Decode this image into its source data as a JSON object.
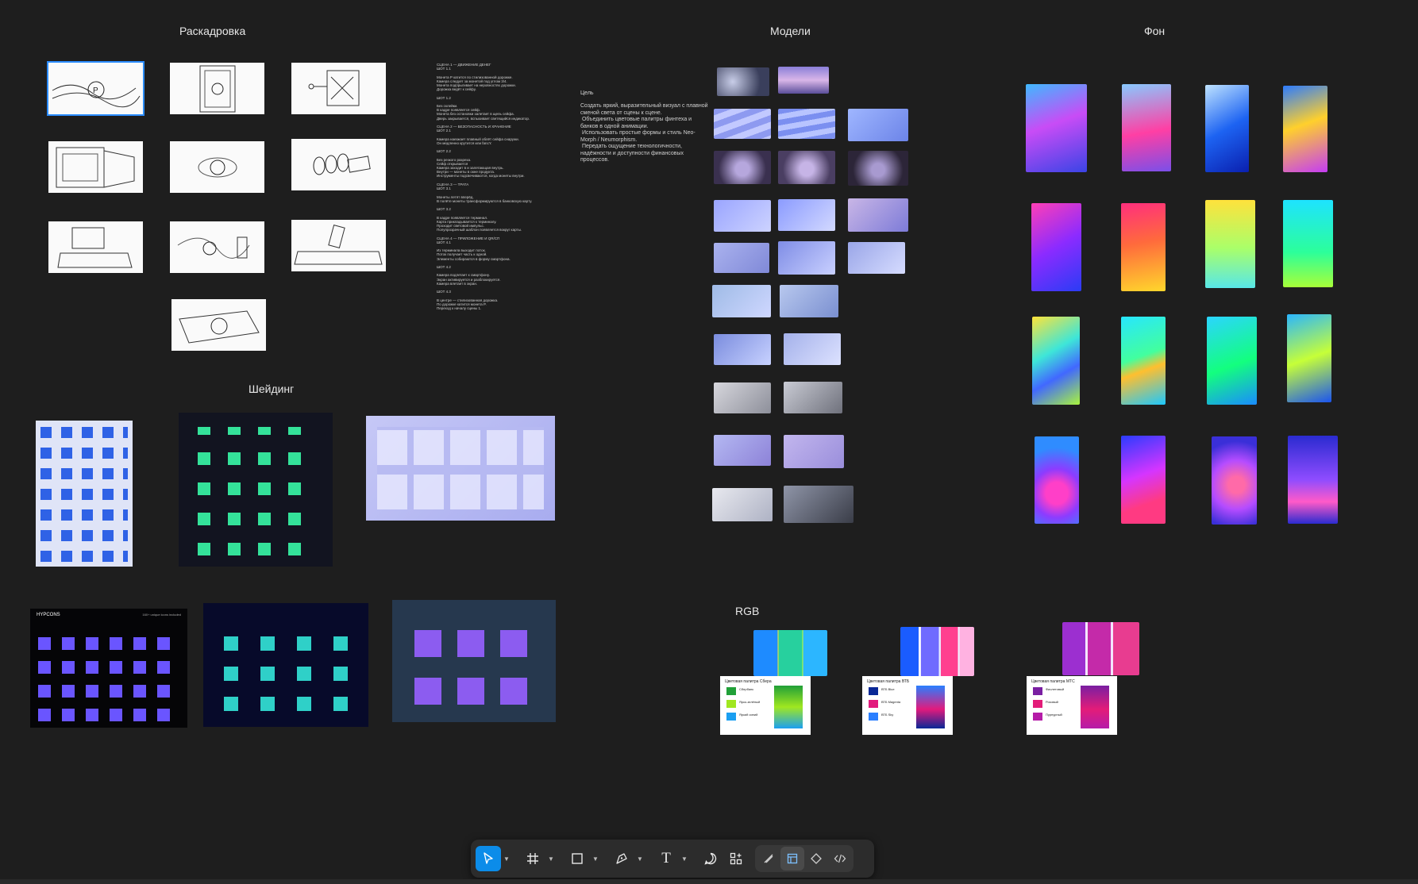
{
  "sections": {
    "storyboard": "Раскадровка",
    "models": "Модели",
    "background": "Фон",
    "shading": "Шейдинг",
    "rgb": "RGB"
  },
  "script_text": "СЦЕНА 1 — ДВИЖЕНИЕ ДЕНЕГ\nШОТ 1.1\n\nМонета P катится по стилизованной дорожке.\nКамера следует за монетой под углом 3/4.\nМонета подпрыгивает на неровностях дорожки.\nДорожка ведёт к сейфу.\n\nШОТ 1.2\n\nБез склейки.\nВ кадре появляется сейф.\nМонета без остановки залетает в щель сейфа.\nДверь закрывается, вспыхивает светящийся индикатор.\n\nСЦЕНА 2 — БЕЗОПАСНОСТЬ И ХРАНЕНИЕ\nШОТ 2.1\n\nКамера наезжает плавный облёт сейфа снаружи.\nОн медленно крутится или fancY.\n\nШОТ 2.2\n\nБез резкого разреза.\nСейф открывается\nКамера заходит в и залетающая внутрь.\nВнутри — монеты в окне продукта.\nИнструменты подсвечиваются, когда монеты внутри.\n\nСЦЕНА 3 — ТРАТА\nШОТ 3.1\n\nМонеты летят вперёд.\nВ полёте монеты трансформируются в банковскую карту.\n\nШОТ 3.2\n\nВ кадре появляется терминал.\nКарта прикладывается к терминалу.\nПроходит световой импульс.\nПолупрозрачный шаблон появляется вокруг карты.\n\nСЦЕНА 4 — ПРИЛОЖЕНИЕ И QR/СП\nШОТ 4.1\n\nИз терминала выходит поток.\nПоток получает часть к одной.\nЭлементы собираются в форму смартфона.\n\nШОТ 4.2\n\nКамера подлетает к смартфону.\nЭкран активируется и разблокируется.\nКамера влетает в экран.\n\nШОТ 4.3\n\nВ центре — стилизованная дорожка.\nПо дорожке катится монета P.\nПереход к началу сцены 1.",
  "goal": {
    "title": "Цель",
    "text": "Создать яркий, выразительный визуал с плавной\nсменой света от сцены к сцене.\n Объединить цветовые палитры финтеха и\nбанков в одной анимации.\n Использовать простые формы и стиль Neo-\nMorph / Neumorphism.\n Передать ощущение технологичности,\nнадёжности и доступности финансовых\nпроцессов."
  },
  "hypercons": {
    "brand": "HYPCONS",
    "subtitle": "160+ unique icons included"
  },
  "palettes": [
    {
      "title": "Цветовая палитра Сбера",
      "rows": [
        {
          "name": "Сбербанк",
          "hex": "#21A038"
        },
        {
          "name": "Ярко-зелёный",
          "hex": "#A0E720"
        },
        {
          "name": "Яркий синий",
          "hex": "#1B9FF1"
        }
      ]
    },
    {
      "title": "Цветовая палитра ВТБ",
      "rows": [
        {
          "name": "ВТБ Blue",
          "hex": "#0A2896"
        },
        {
          "name": "ВТБ Magenta",
          "hex": "#E21A7D"
        },
        {
          "name": "ВТБ Sky",
          "hex": "#2A7FFF"
        }
      ]
    },
    {
      "title": "Цветовая палитра МТС",
      "rows": [
        {
          "name": "Фиолетовый",
          "hex": "#7A1FA2"
        },
        {
          "name": "Розовый",
          "hex": "#E31C79"
        },
        {
          "name": "Пурпурный",
          "hex": "#B51CA8"
        }
      ]
    }
  ],
  "toolbar": {
    "move": "move-tool-icon",
    "frame": "frame-tool-icon",
    "shape": "rectangle-tool-icon",
    "pen": "pen-tool-icon",
    "text": "text-tool-icon",
    "comment": "comment-tool-icon",
    "actions": "actions-icon",
    "draw": "draw-mode-icon",
    "design": "design-mode-icon",
    "prototype": "prototype-mode-icon",
    "dev": "dev-mode-icon",
    "text_glyph": "T"
  },
  "colors": {
    "canvas": "#1e1e1e",
    "accent": "#0c8ce9",
    "selection": "#2b8cff"
  }
}
